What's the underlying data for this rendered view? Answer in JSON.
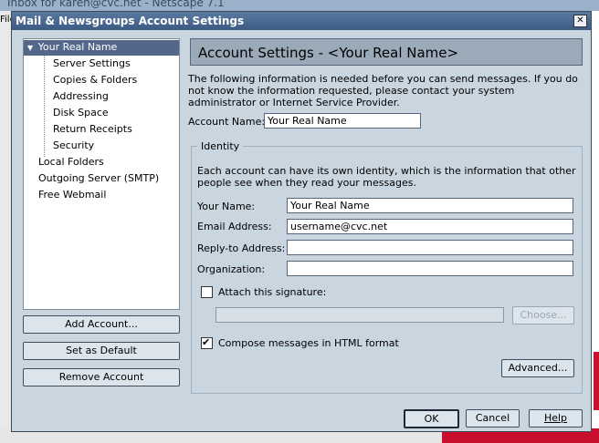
{
  "background": {
    "title": "Inbox for karen@cvc.net - Netscape 7.1",
    "menu_fragment": "File"
  },
  "dialog": {
    "title": "Mail & Newsgroups Account Settings",
    "close_glyph": "✕"
  },
  "tree": {
    "account": "Your Real Name",
    "expander_glyph": "▼",
    "children": [
      "Server Settings",
      "Copies & Folders",
      "Addressing",
      "Disk Space",
      "Return Receipts",
      "Security"
    ],
    "others": [
      "Local Folders",
      "Outgoing Server (SMTP)",
      "Free Webmail"
    ]
  },
  "side_buttons": {
    "add_account": "Add Account...",
    "set_default": "Set as Default",
    "remove_account": "Remove Account"
  },
  "panel": {
    "header": "Account Settings - <Your Real Name>",
    "intro": "The following information is needed before you can send messages. If you do not know the information requested, please contact your system administrator or Internet Service Provider.",
    "account_name_label": "Account Name:",
    "account_name_value": "Your Real Name"
  },
  "identity": {
    "legend": "Identity",
    "description": "Each account can have its own identity, which is the information that other people see when they read your messages.",
    "your_name_label": "Your Name:",
    "your_name_value": "Your Real Name",
    "email_label": "Email Address:",
    "email_value": "username@cvc.net",
    "reply_to_label": "Reply-to Address:",
    "reply_to_value": "",
    "organization_label": "Organization:",
    "organization_value": "",
    "attach_signature_label": "Attach this signature:",
    "attach_signature_checked": false,
    "signature_path_value": "",
    "choose_label": "Choose...",
    "compose_html_label": "Compose messages in HTML format",
    "compose_html_checked": true,
    "check_glyph": "✔",
    "advanced_label": "Advanced..."
  },
  "footer": {
    "ok": "OK",
    "cancel": "Cancel",
    "help": "Help"
  }
}
